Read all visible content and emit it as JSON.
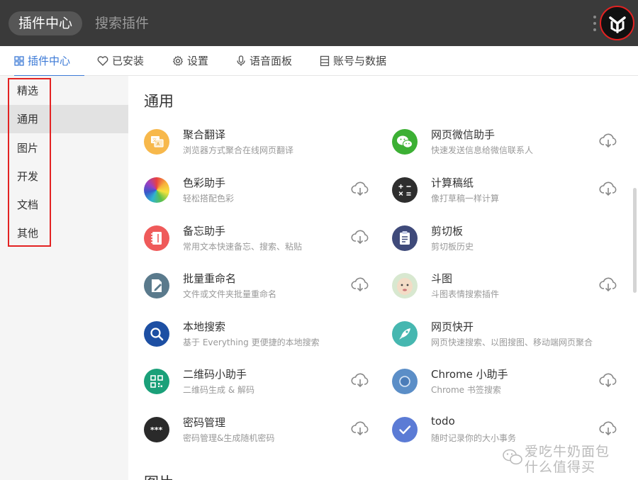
{
  "header": {
    "title": "插件中心",
    "search_placeholder": "搜索插件",
    "logo_icon": "yuanli-logo-icon"
  },
  "tabs": [
    {
      "label": "插件中心",
      "icon": "grid-icon",
      "active": true
    },
    {
      "label": "已安装",
      "icon": "heart-icon",
      "active": false
    },
    {
      "label": "设置",
      "icon": "gear-icon",
      "active": false
    },
    {
      "label": "语音面板",
      "icon": "microphone-icon",
      "active": false
    },
    {
      "label": "账号与数据",
      "icon": "database-icon",
      "active": false
    }
  ],
  "sidebar": {
    "items": [
      {
        "label": "精选",
        "active": false
      },
      {
        "label": "通用",
        "active": true
      },
      {
        "label": "图片",
        "active": false
      },
      {
        "label": "开发",
        "active": false
      },
      {
        "label": "文档",
        "active": false
      },
      {
        "label": "其他",
        "active": false
      }
    ]
  },
  "main": {
    "section_title": "通用",
    "next_section_title": "图片",
    "plugins": [
      {
        "name": "聚合翻译",
        "desc": "浏览器方式聚合在线网页翻译",
        "icon": "translate-icon",
        "color": "#f7b84b",
        "download": false
      },
      {
        "name": "网页微信助手",
        "desc": "快速发送信息给微信联系人",
        "icon": "wechat-icon",
        "color": "#3cb034",
        "download": true
      },
      {
        "name": "色彩助手",
        "desc": "轻松搭配色彩",
        "icon": "color-wheel-icon",
        "color": "#e94040",
        "download": true
      },
      {
        "name": "计算稿纸",
        "desc": "像打草稿一样计算",
        "icon": "calculator-icon",
        "color": "#2e2e2e",
        "download": true
      },
      {
        "name": "备忘助手",
        "desc": "常用文本快速备忘、搜索、粘贴",
        "icon": "notebook-icon",
        "color": "#ef5a5a",
        "download": true
      },
      {
        "name": "剪切板",
        "desc": "剪切板历史",
        "icon": "clipboard-icon",
        "color": "#3f4a7a",
        "download": false
      },
      {
        "name": "批量重命名",
        "desc": "文件或文件夹批量重命名",
        "icon": "rename-icon",
        "color": "#5a7a8c",
        "download": true
      },
      {
        "name": "斗图",
        "desc": "斗图表情搜索插件",
        "icon": "baby-face-icon",
        "color": "#d8e8d0",
        "download": true
      },
      {
        "name": "本地搜索",
        "desc": "基于 Everything 更便捷的本地搜索",
        "icon": "magnifier-icon",
        "color": "#1d4fa3",
        "download": false
      },
      {
        "name": "网页快开",
        "desc": "网页快速搜索、以图搜图、移动端网页聚合",
        "icon": "rocket-icon",
        "color": "#46b7b0",
        "download": false
      },
      {
        "name": "二维码小助手",
        "desc": "二维码生成 & 解码",
        "icon": "qrcode-icon",
        "color": "#1aa079",
        "download": true
      },
      {
        "name": "Chrome 小助手",
        "desc": "Chrome 书签搜索",
        "icon": "chrome-icon",
        "color": "#5b8ec7",
        "download": true
      },
      {
        "name": "密码管理",
        "desc": "密码管理&生成随机密码",
        "icon": "password-icon",
        "color": "#2a2a2a",
        "download": true
      },
      {
        "name": "todo",
        "desc": "随时记录你的大小事务",
        "icon": "check-icon",
        "color": "#5b7bd5",
        "download": true
      }
    ]
  },
  "watermark": {
    "line1": "爱吃牛奶面包",
    "line2": "什么值得买"
  }
}
